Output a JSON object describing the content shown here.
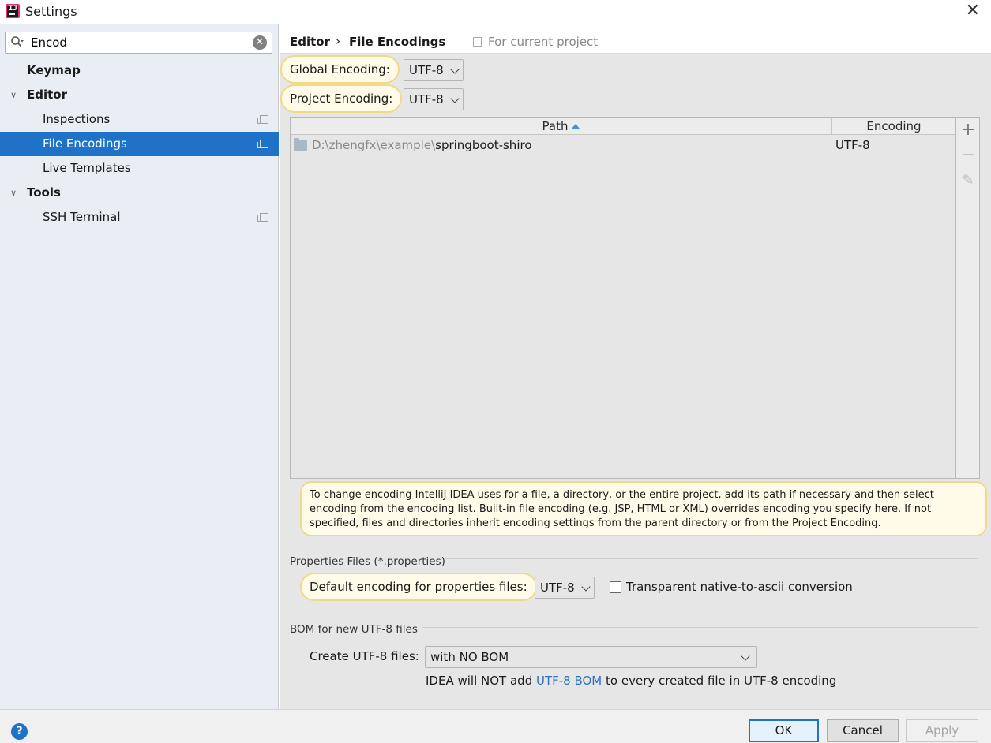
{
  "window": {
    "title": "Settings",
    "close_symbol": "✕"
  },
  "sidebar": {
    "search": {
      "value": "Encod",
      "placeholder": ""
    },
    "items": [
      {
        "label": "Keymap",
        "level": 0,
        "bold": true
      },
      {
        "label": "Editor",
        "level": 0,
        "bold": true,
        "expanded": true
      },
      {
        "label": "Inspections",
        "level": 1
      },
      {
        "label": "File Encodings",
        "level": 1,
        "selected": true
      },
      {
        "label": "Live Templates",
        "level": 1
      },
      {
        "label": "Tools",
        "level": 0,
        "bold": true,
        "expanded": true
      },
      {
        "label": "SSH Terminal",
        "level": 1
      }
    ]
  },
  "breadcrumb": {
    "parent": "Editor",
    "separator": "›",
    "current": "File Encodings",
    "scope": "For current project"
  },
  "encodings": {
    "global_label": "Global Encoding:",
    "global_value": "UTF-8",
    "project_label": "Project Encoding:",
    "project_value": "UTF-8"
  },
  "table": {
    "columns": [
      "Path",
      "Encoding"
    ],
    "sort_column": "Path",
    "sort_direction": "ascending",
    "rows": [
      {
        "path_prefix": "D:\\zhengfx\\example\\",
        "path_name": "springboot-shiro",
        "encoding": "UTF-8"
      }
    ],
    "tools": [
      "+",
      "−",
      "✎"
    ]
  },
  "info_text": "To change encoding IntelliJ IDEA uses for a file, a directory, or the entire project, add its path if necessary and then select encoding from the encoding list. Built-in file encoding (e.g. JSP, HTML or XML) overrides encoding you specify here. If not specified, files and directories inherit encoding settings from the parent directory or from the Project Encoding.",
  "properties": {
    "group_title": "Properties Files (*.properties)",
    "default_label": "Default encoding for properties files:",
    "default_value": "UTF-8",
    "transparent_label": "Transparent native-to-ascii conversion",
    "transparent_checked": false
  },
  "bom": {
    "group_title": "BOM for new UTF-8 files",
    "create_label": "Create UTF-8 files:",
    "create_value": "with NO BOM",
    "note_prefix": "IDEA will NOT add ",
    "note_link": "UTF-8 BOM",
    "note_suffix": " to every created file in UTF-8 encoding"
  },
  "footer": {
    "help_symbol": "?",
    "ok": "OK",
    "cancel": "Cancel",
    "apply": "Apply"
  },
  "colors": {
    "selection": "#1e72c8",
    "highlight_bg": "#fffbe8",
    "highlight_border": "#f1d98a",
    "link": "#2b72c5"
  }
}
